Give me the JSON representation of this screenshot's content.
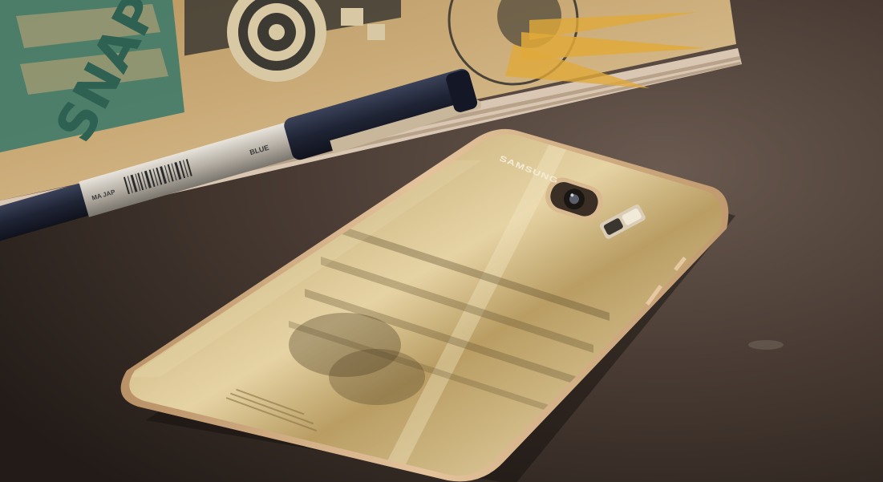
{
  "photo": {
    "phone_brand": "SAMSUNG",
    "pen_label_color": "BLUE",
    "pen_label_maker": "MA JAP",
    "notebook_word": "SNAP"
  },
  "colors": {
    "table": "#3a2f29",
    "notebook_cover": "#c9a877",
    "notebook_teal": "#3f7a69",
    "pen_body": "#23283a",
    "phone_gold": "#c8ab6e",
    "phone_frame": "#d7b486"
  }
}
